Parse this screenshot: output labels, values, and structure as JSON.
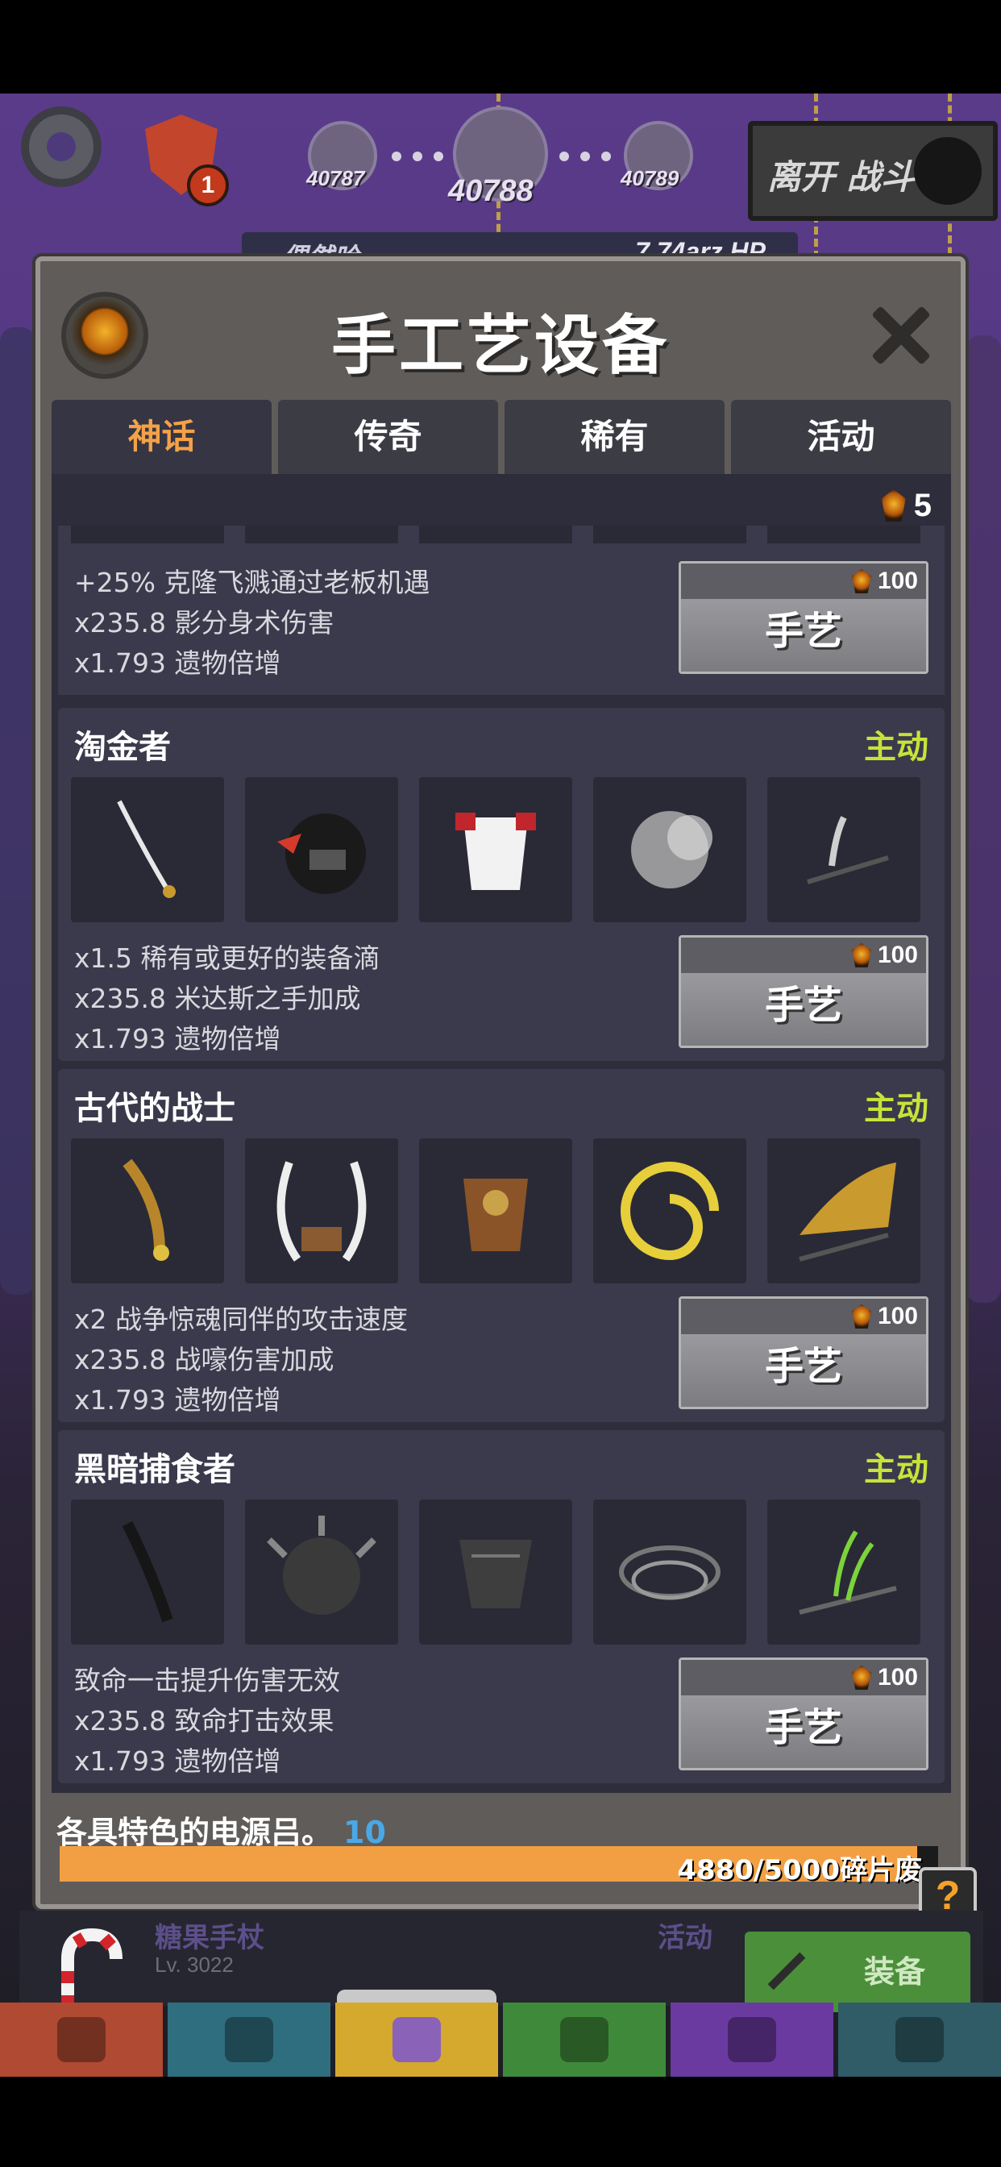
{
  "hud": {
    "notification_count": "1",
    "stages": [
      "40787",
      "40788",
      "40789"
    ],
    "leave_battle": "离开 战斗",
    "boss_name": "偶然哈",
    "boss_hp": "7.74arz HP"
  },
  "modal": {
    "title": "手工艺设备",
    "tabs": [
      "神话",
      "传奇",
      "稀有",
      "活动"
    ],
    "active_tab": "神话",
    "currency_amount": "5"
  },
  "sets": [
    {
      "name": "",
      "status": "",
      "bonuses": [
        "+25% 克隆飞溅通过老板机遇",
        "x235.8 影分身术伤害",
        "x1.793 遗物倍增"
      ],
      "cost": "100",
      "craft_label": "手艺"
    },
    {
      "name": "淘金者",
      "status": "主动",
      "items": [
        "saber-icon",
        "helmet-icon",
        "white-armor-icon",
        "smoke-aura-icon",
        "dark-slash-icon"
      ],
      "bonuses": [
        "x1.5 稀有或更好的装备滴",
        "x235.8 米达斯之手加成",
        "x1.793 遗物倍增"
      ],
      "cost": "100",
      "craft_label": "手艺"
    },
    {
      "name": "古代的战士",
      "status": "主动",
      "items": [
        "golden-dagger-icon",
        "horned-helmet-icon",
        "bronze-armor-icon",
        "golden-horn-aura-icon",
        "golden-slash-icon"
      ],
      "bonuses": [
        "x2 战争惊魂同伴的攻击速度",
        "x235.8 战嚎伤害加成",
        "x1.793 遗物倍增"
      ],
      "cost": "100",
      "craft_label": "手艺"
    },
    {
      "name": "黑暗捕食者",
      "status": "主动",
      "items": [
        "dark-blade-icon",
        "spiked-helmet-icon",
        "dark-armor-icon",
        "dark-swirl-aura-icon",
        "green-slash-icon"
      ],
      "bonuses": [
        "致命一击提升伤害无效",
        "x235.8 致命打击效果",
        "x1.793 遗物倍增"
      ],
      "cost": "100",
      "craft_label": "手艺"
    }
  ],
  "footer": {
    "label": "各具特色的电源吕。",
    "count": "10",
    "progress_text": "4880/5000碎片废",
    "progress_fraction": 0.976,
    "help": "?"
  },
  "equipped": {
    "name": "糖果手杖",
    "level": "Lv. 3022",
    "status": "活动",
    "equip_label": "装备"
  },
  "bottom_nav": [
    "sword-tab-icon",
    "hero-tab-icon",
    "equipment-tab-icon",
    "pet-tab-icon",
    "heart-tab-icon",
    "shop-tab-icon"
  ],
  "colors": {
    "accent_orange": "#f4a148",
    "active_green": "#c7e33a",
    "count_blue": "#4aa8e6",
    "nav": [
      "#b04a33",
      "#2f6e7e",
      "#d4a92e",
      "#3f8a3a",
      "#6a3aa0",
      "#2f5c66"
    ]
  }
}
